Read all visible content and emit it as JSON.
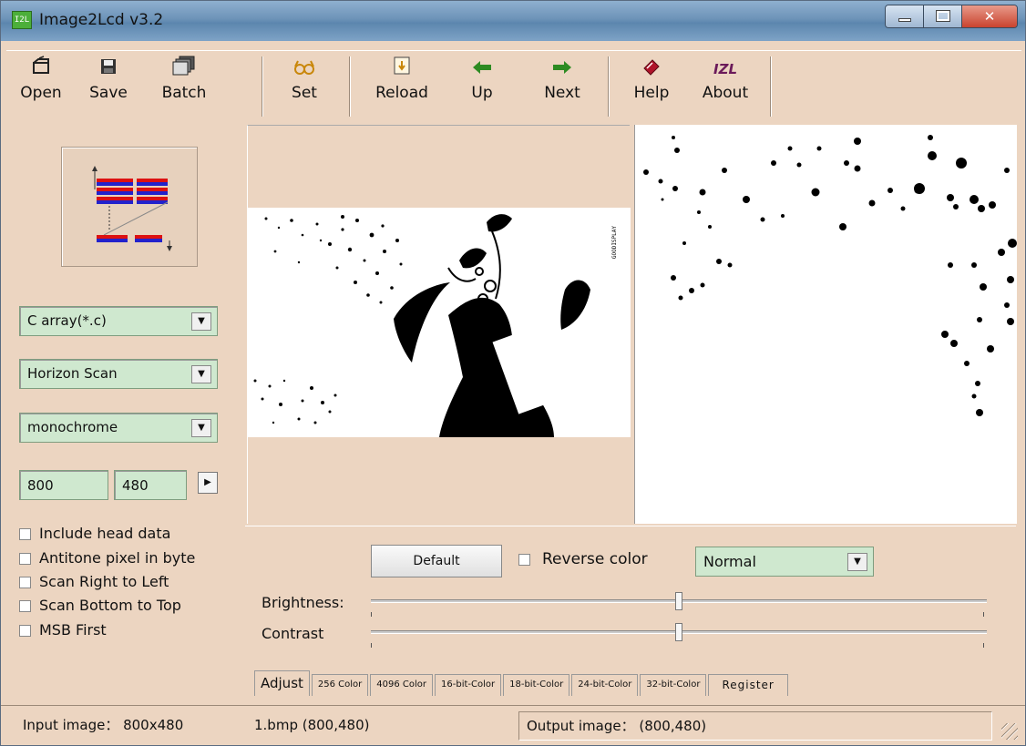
{
  "window": {
    "title": "Image2Lcd v3.2",
    "icon_text": "I2L"
  },
  "toolbar": {
    "items": [
      {
        "label": "Open",
        "icon": "open-icon"
      },
      {
        "label": "Save",
        "icon": "save-icon"
      },
      {
        "label": "Batch",
        "icon": "batch-icon"
      },
      {
        "label": "Set",
        "icon": "set-icon"
      },
      {
        "label": "Reload",
        "icon": "reload-icon"
      },
      {
        "label": "Up",
        "icon": "up-arrow-icon"
      },
      {
        "label": "Next",
        "icon": "next-arrow-icon"
      },
      {
        "label": "Help",
        "icon": "help-icon"
      },
      {
        "label": "About",
        "icon": "about-icon",
        "icon_text": "IZL"
      }
    ]
  },
  "left_panel": {
    "output_type": "C array(*.c)",
    "scan_mode": "Horizon Scan",
    "color_depth": "monochrome",
    "width": "800",
    "height": "480",
    "checkboxes": [
      {
        "label": "Include head data",
        "checked": false
      },
      {
        "label": "Antitone pixel in byte",
        "checked": false
      },
      {
        "label": "Scan Right to Left",
        "checked": false
      },
      {
        "label": "Scan Bottom to Top",
        "checked": false
      },
      {
        "label": "MSB First",
        "checked": false
      }
    ]
  },
  "preview": {
    "watermark_text": "GOODISPLAY"
  },
  "adjust": {
    "default_label": "Default",
    "reverse_label": "Reverse color",
    "mode": "Normal",
    "brightness_label": "Brightness:",
    "contrast_label": "Contrast",
    "brightness_value": 0.5,
    "contrast_value": 0.5,
    "tabs": [
      "Adjust",
      "256 Color",
      "4096 Color",
      "16-bit-Color",
      "18-bit-Color",
      "24-bit-Color",
      "32-bit-Color",
      "Register"
    ]
  },
  "status": {
    "input": "Input image： 800x480",
    "file": "1.bmp  (800,480)",
    "output": "Output image： (800,480)"
  },
  "colors": {
    "window_bg": "#ecd5c1",
    "field_bg": "#cfe8cf"
  }
}
